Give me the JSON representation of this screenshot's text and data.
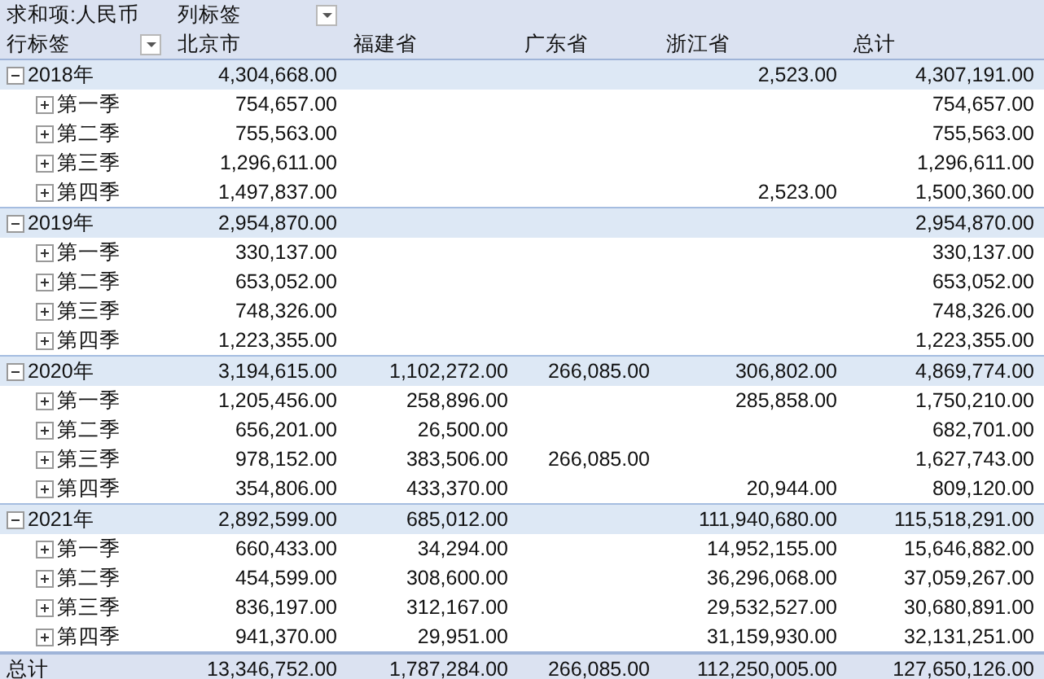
{
  "pivot": {
    "value_field": "求和项:人民币",
    "column_label": "列标签",
    "row_label": "行标签",
    "columns": [
      "北京市",
      "福建省",
      "广东省",
      "浙江省",
      "总计"
    ],
    "groups": [
      {
        "label": "2018年",
        "expanded": true,
        "values": {
          "column_1": "4,304,668.00",
          "column_4": "2,523.00",
          "column_5": "4,307,191.00"
        },
        "children": [
          {
            "label": "第一季",
            "expanded": false,
            "values": {
              "column_1": "754,657.00",
              "column_5": "754,657.00"
            }
          },
          {
            "label": "第二季",
            "expanded": false,
            "values": {
              "column_1": "755,563.00",
              "column_5": "755,563.00"
            }
          },
          {
            "label": "第三季",
            "expanded": false,
            "values": {
              "column_1": "1,296,611.00",
              "column_5": "1,296,611.00"
            }
          },
          {
            "label": "第四季",
            "expanded": false,
            "values": {
              "column_1": "1,497,837.00",
              "column_4": "2,523.00",
              "column_5": "1,500,360.00"
            }
          }
        ]
      },
      {
        "label": "2019年",
        "expanded": true,
        "values": {
          "column_1": "2,954,870.00",
          "column_5": "2,954,870.00"
        },
        "children": [
          {
            "label": "第一季",
            "expanded": false,
            "values": {
              "column_1": "330,137.00",
              "column_5": "330,137.00"
            }
          },
          {
            "label": "第二季",
            "expanded": false,
            "values": {
              "column_1": "653,052.00",
              "column_5": "653,052.00"
            }
          },
          {
            "label": "第三季",
            "expanded": false,
            "values": {
              "column_1": "748,326.00",
              "column_5": "748,326.00"
            }
          },
          {
            "label": "第四季",
            "expanded": false,
            "values": {
              "column_1": "1,223,355.00",
              "column_5": "1,223,355.00"
            }
          }
        ]
      },
      {
        "label": "2020年",
        "expanded": true,
        "values": {
          "column_1": "3,194,615.00",
          "column_2": "1,102,272.00",
          "column_3": "266,085.00",
          "column_4": "306,802.00",
          "column_5": "4,869,774.00"
        },
        "children": [
          {
            "label": "第一季",
            "expanded": false,
            "values": {
              "column_1": "1,205,456.00",
              "column_2": "258,896.00",
              "column_4": "285,858.00",
              "column_5": "1,750,210.00"
            }
          },
          {
            "label": "第二季",
            "expanded": false,
            "values": {
              "column_1": "656,201.00",
              "column_2": "26,500.00",
              "column_5": "682,701.00"
            }
          },
          {
            "label": "第三季",
            "expanded": false,
            "values": {
              "column_1": "978,152.00",
              "column_2": "383,506.00",
              "column_3": "266,085.00",
              "column_5": "1,627,743.00"
            }
          },
          {
            "label": "第四季",
            "expanded": false,
            "values": {
              "column_1": "354,806.00",
              "column_2": "433,370.00",
              "column_4": "20,944.00",
              "column_5": "809,120.00"
            }
          }
        ]
      },
      {
        "label": "2021年",
        "expanded": true,
        "values": {
          "column_1": "2,892,599.00",
          "column_2": "685,012.00",
          "column_4": "111,940,680.00",
          "column_5": "115,518,291.00"
        },
        "children": [
          {
            "label": "第一季",
            "expanded": false,
            "values": {
              "column_1": "660,433.00",
              "column_2": "34,294.00",
              "column_4": "14,952,155.00",
              "column_5": "15,646,882.00"
            }
          },
          {
            "label": "第二季",
            "expanded": false,
            "values": {
              "column_1": "454,599.00",
              "column_2": "308,600.00",
              "column_4": "36,296,068.00",
              "column_5": "37,059,267.00"
            }
          },
          {
            "label": "第三季",
            "expanded": false,
            "values": {
              "column_1": "836,197.00",
              "column_2": "312,167.00",
              "column_4": "29,532,527.00",
              "column_5": "30,680,891.00"
            }
          },
          {
            "label": "第四季",
            "expanded": false,
            "values": {
              "column_1": "941,370.00",
              "column_2": "29,951.00",
              "column_4": "31,159,930.00",
              "column_5": "32,131,251.00"
            }
          }
        ]
      }
    ],
    "grand_total": {
      "label": "总计",
      "values": {
        "column_1": "13,346,752.00",
        "column_2": "1,787,284.00",
        "column_3": "266,085.00",
        "column_4": "112,250,005.00",
        "column_5": "127,650,126.00"
      }
    }
  }
}
